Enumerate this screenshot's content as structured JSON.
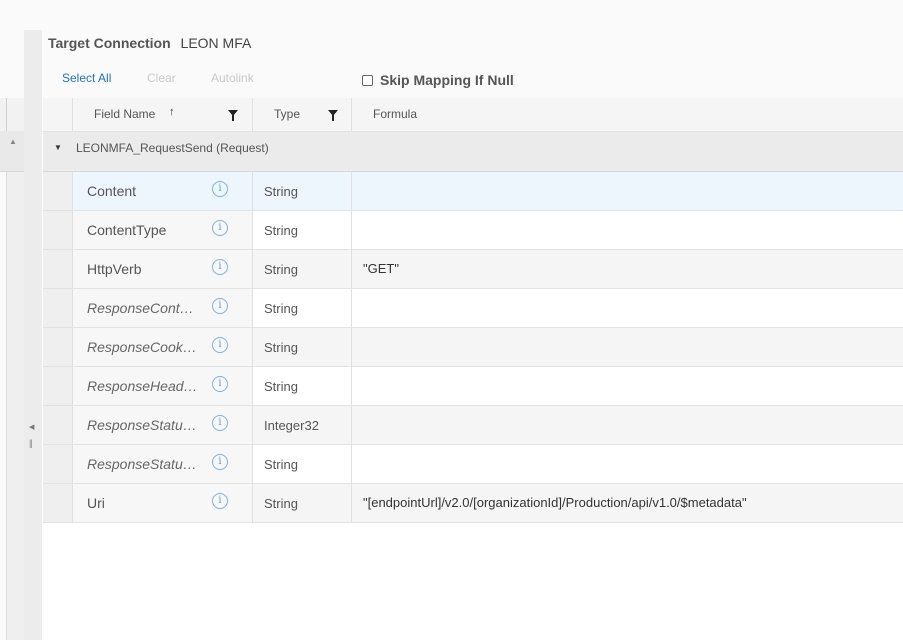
{
  "header": {
    "target_label": "Target Connection",
    "target_value": "LEON MFA"
  },
  "toolbar": {
    "select_all": "Select All",
    "clear": "Clear",
    "autolink": "Autolink",
    "skip_label": "Skip Mapping If Null"
  },
  "grid": {
    "columns": {
      "field_name": "Field Name",
      "type": "Type",
      "formula": "Formula"
    },
    "group": "LEONMFA_RequestSend (Request)",
    "rows": [
      {
        "name": "Content",
        "type": "String",
        "formula": ""
      },
      {
        "name": "ContentType",
        "type": "String",
        "formula": ""
      },
      {
        "name": "HttpVerb",
        "type": "String",
        "formula": "\"GET\""
      },
      {
        "name": "ResponseContentType",
        "type": "String",
        "formula": ""
      },
      {
        "name": "ResponseCookies",
        "type": "String",
        "formula": ""
      },
      {
        "name": "ResponseHeaders",
        "type": "String",
        "formula": ""
      },
      {
        "name": "ResponseStatusCode",
        "type": "Integer32",
        "formula": ""
      },
      {
        "name": "ResponseStatusText",
        "type": "String",
        "formula": ""
      },
      {
        "name": "Uri",
        "type": "String",
        "formula": "\"[endpointUrl]/v2.0/[organizationId]/Production/api/v1.0/$metadata\""
      }
    ]
  },
  "icons": {
    "sort": "sort-ascending-icon",
    "filter": "filter-icon",
    "info": "info-icon",
    "expand": "triangle-down-icon"
  }
}
